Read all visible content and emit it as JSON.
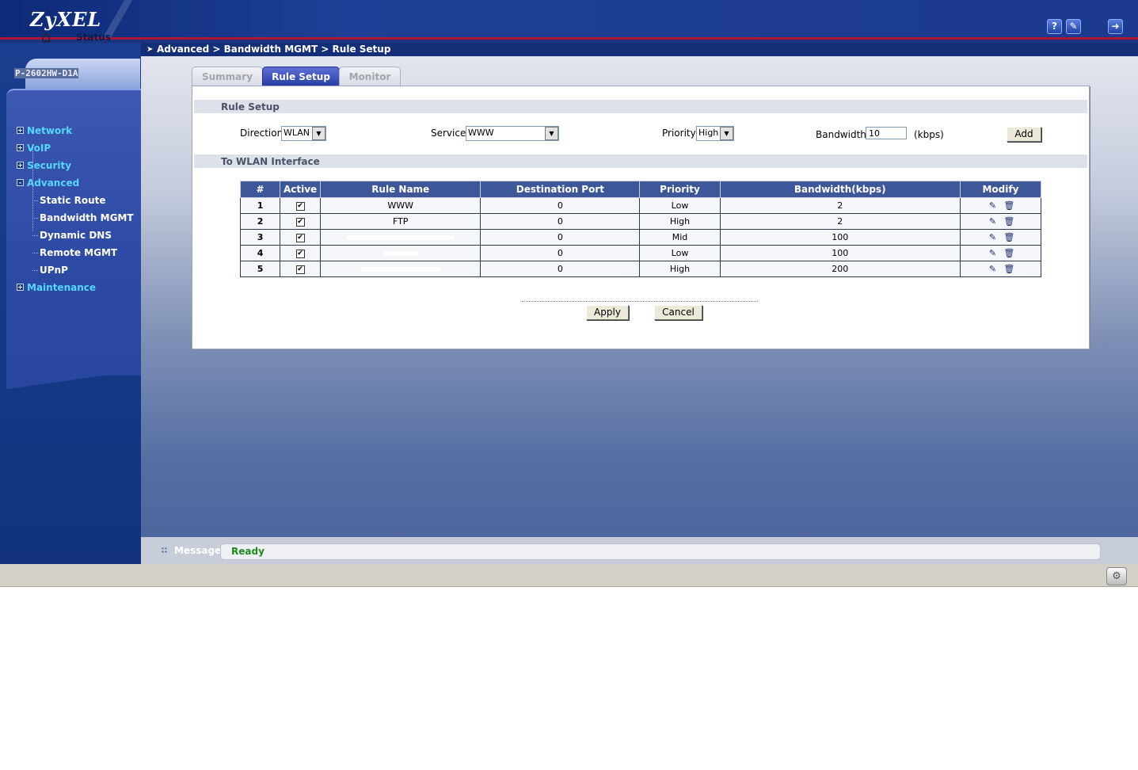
{
  "header": {
    "logo": "ZyXEL",
    "help_icon": "?",
    "wizard_icon": "wand-icon",
    "logout_icon": "logout-icon"
  },
  "sidebar": {
    "status_label": "Status",
    "model": "P-2602HW-D1A",
    "items": [
      {
        "label": "Network",
        "expand": "+"
      },
      {
        "label": "VoIP",
        "expand": "+"
      },
      {
        "label": "Security",
        "expand": "+"
      },
      {
        "label": "Advanced",
        "expand": "-"
      },
      {
        "label": "Maintenance",
        "expand": "+"
      }
    ],
    "advanced_sub": [
      {
        "label": "Static Route"
      },
      {
        "label": "Bandwidth MGMT"
      },
      {
        "label": "Dynamic DNS"
      },
      {
        "label": "Remote MGMT"
      },
      {
        "label": "UPnP"
      }
    ]
  },
  "breadcrumb": "Advanced > Bandwidth MGMT > Rule Setup",
  "tabs": [
    {
      "label": "Summary"
    },
    {
      "label": "Rule Setup"
    },
    {
      "label": "Monitor"
    }
  ],
  "rule_setup": {
    "title": "Rule Setup",
    "direction_label": "Direction",
    "direction_value": "WLAN",
    "service_label": "Service",
    "service_value": "WWW",
    "priority_label": "Priority",
    "priority_value": "High",
    "bandwidth_label": "Bandwidth",
    "bandwidth_value": "10",
    "bandwidth_unit": "(kbps)",
    "add_label": "Add"
  },
  "interface_section": {
    "title": "To WLAN Interface",
    "columns": [
      "#",
      "Active",
      "Rule Name",
      "Destination Port",
      "Priority",
      "Bandwidth(kbps)",
      "Modify"
    ],
    "rows": [
      {
        "num": "1",
        "active": "✔",
        "name": "WWW",
        "port": "0",
        "priority": "Low",
        "bandwidth": "2"
      },
      {
        "num": "2",
        "active": "✔",
        "name": "FTP",
        "port": "0",
        "priority": "High",
        "bandwidth": "2"
      },
      {
        "num": "3",
        "active": "✔",
        "name": "",
        "port": "0",
        "priority": "Mid",
        "bandwidth": "100"
      },
      {
        "num": "4",
        "active": "✔",
        "name": "",
        "port": "0",
        "priority": "Low",
        "bandwidth": "100"
      },
      {
        "num": "5",
        "active": "✔",
        "name": "",
        "port": "0",
        "priority": "High",
        "bandwidth": "200"
      }
    ]
  },
  "actions": {
    "apply_label": "Apply",
    "cancel_label": "Cancel"
  },
  "message": {
    "label": "Message",
    "text": "Ready"
  }
}
